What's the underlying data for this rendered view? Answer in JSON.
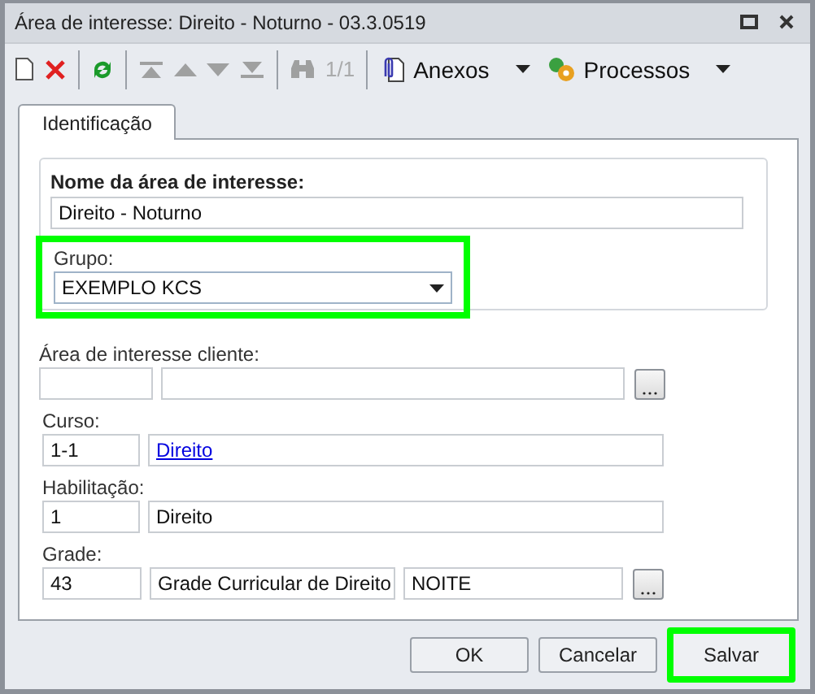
{
  "window": {
    "title": "Área de interesse: Direito - Noturno - 03.3.0519"
  },
  "toolbar": [
    {
      "kind": "new",
      "disabled": false
    },
    {
      "kind": "delete",
      "disabled": false
    },
    {
      "kind": "separator"
    },
    {
      "kind": "refresh",
      "disabled": false
    },
    {
      "kind": "separator"
    },
    {
      "kind": "first",
      "disabled": true
    },
    {
      "kind": "previous",
      "disabled": true
    },
    {
      "kind": "next",
      "disabled": true
    },
    {
      "kind": "last",
      "disabled": true
    },
    {
      "kind": "separator"
    },
    {
      "kind": "find",
      "disabled": true
    },
    {
      "kind": "counter",
      "text": "1/1",
      "disabled": true
    },
    {
      "kind": "separator"
    },
    {
      "kind": "attachments",
      "text": "Anexos",
      "disabled": false
    },
    {
      "kind": "processes",
      "text": "Processos",
      "disabled": false
    }
  ],
  "tabs": [
    {
      "label": "Identificação",
      "selected": true
    }
  ],
  "group": {
    "name_label": "Nome da área de interesse:",
    "name_value": "Direito - Noturno",
    "grupo_label": "Grupo:",
    "grupo_value": "EXEMPLO KCS",
    "grupo_highlighted": true
  },
  "sections": [
    {
      "label": "Área de interesse cliente:",
      "inputs": [
        {
          "kind": "text"
        },
        {
          "kind": "text"
        }
      ],
      "lookup": true
    },
    {
      "label": "Curso:",
      "inputs": [
        {
          "kind": "text",
          "value": "1-1"
        },
        {
          "kind": "link",
          "value": "Direito"
        }
      ],
      "lookup": false
    },
    {
      "label": "Habilitação:",
      "inputs": [
        {
          "kind": "text",
          "value": "1"
        },
        {
          "kind": "text",
          "value": "Direito"
        }
      ],
      "lookup": false
    },
    {
      "label": "Grade:",
      "inputs": [
        {
          "kind": "text",
          "value": "43"
        },
        {
          "kind": "text",
          "value": "Grade Curricular de Direito"
        },
        {
          "kind": "text",
          "value": "NOITE"
        }
      ],
      "lookup": true
    }
  ],
  "buttons": [
    {
      "label": "OK",
      "highlighted": false
    },
    {
      "label": "Cancelar",
      "highlighted": false
    },
    {
      "label": "Salvar",
      "highlighted": true
    }
  ]
}
